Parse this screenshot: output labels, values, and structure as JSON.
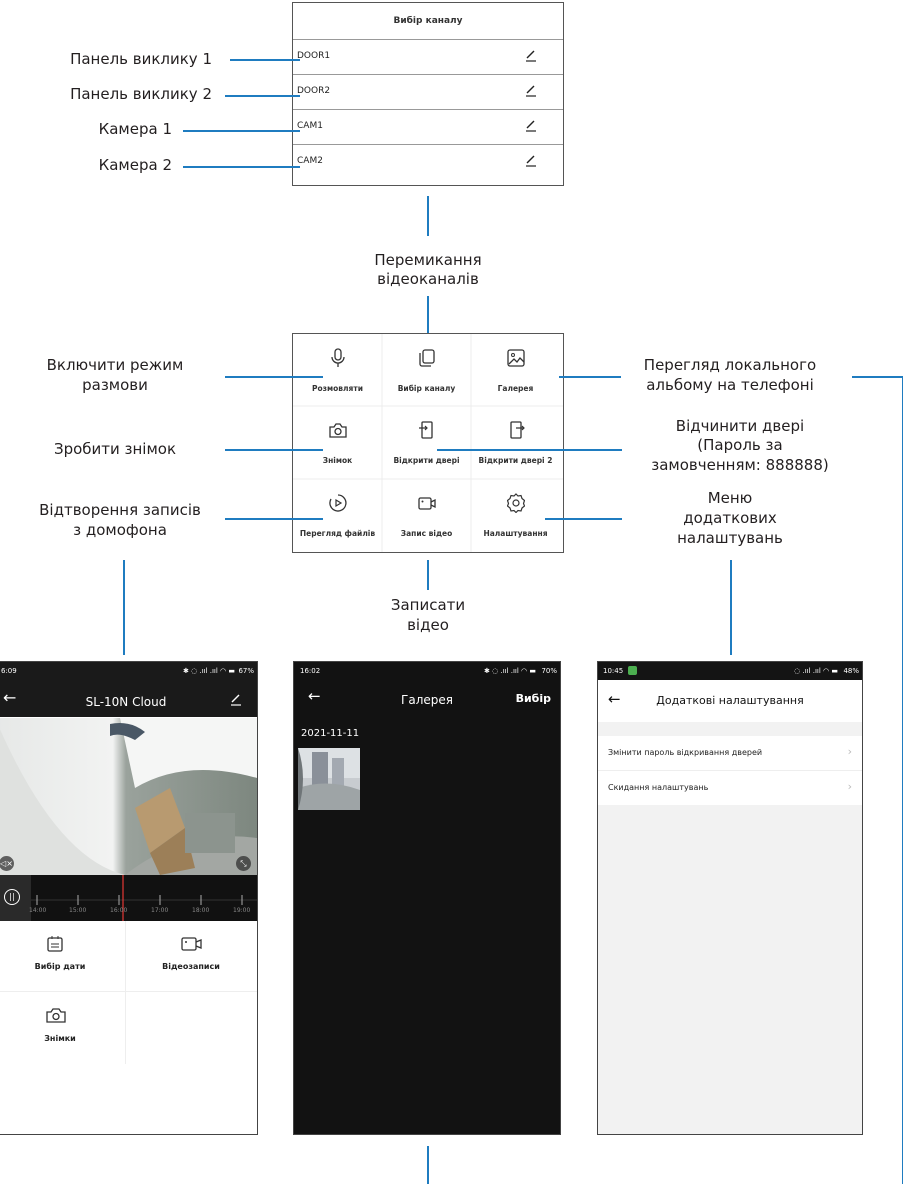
{
  "channel_panel": {
    "title": "Вибір каналу",
    "rows": [
      "DOOR1",
      "DOOR2",
      "CAM1",
      "CAM2"
    ]
  },
  "annotations": {
    "panel1": "Панель виклику 1",
    "panel2": "Панель виклику 2",
    "cam1": "Камера 1",
    "cam2": "Камера 2",
    "switch_l1": "Перемикання",
    "switch_l2": "відеоканалів",
    "talk_l1": "Включити режим",
    "talk_l2": "размови",
    "snap": "Зробити знімок",
    "playback_l1": "Відтворення записів",
    "playback_l2": "з домофона",
    "gallery_l1": "Перегляд локального",
    "gallery_l2": "альбому на телефоні",
    "door_l1": "Відчинити двері",
    "door_l2": "(Пароль за",
    "door_l3": "замовченням: 888888)",
    "menu_l1": "Меню",
    "menu_l2": "додаткових",
    "menu_l3": "налаштувань",
    "rec_l1": "Записати",
    "rec_l2": "відео"
  },
  "grid": {
    "cells": [
      {
        "label": "Розмовляти",
        "icon": "microphone-icon"
      },
      {
        "label": "Вибір каналу",
        "icon": "channel-icon"
      },
      {
        "label": "Галерея",
        "icon": "image-icon"
      },
      {
        "label": "Знімок",
        "icon": "camera-icon"
      },
      {
        "label": "Відкрити двері",
        "icon": "door-open-icon"
      },
      {
        "label": "Відкрити двері 2",
        "icon": "door-open-icon"
      },
      {
        "label": "Перегляд файлів",
        "icon": "play-icon"
      },
      {
        "label": "Запис відео",
        "icon": "video-icon"
      },
      {
        "label": "Налаштування",
        "icon": "gear-icon"
      }
    ]
  },
  "phone1": {
    "time": "6:09",
    "battery": "67%",
    "title": "SL-10N Cloud",
    "timeline_ticks": [
      "14:00",
      "15:00",
      "16:00",
      "17:00",
      "18:00",
      "19:00"
    ],
    "buttons": {
      "date": "Вибір дати",
      "videos": "Відеозаписи",
      "snaps": "Знімки"
    }
  },
  "phone2": {
    "time": "16:02",
    "battery": "70%",
    "title": "Галерея",
    "select": "Вибір",
    "date": "2021-11-11"
  },
  "phone3": {
    "time": "10:45",
    "battery": "48%",
    "title": "Додаткові налаштування",
    "items": [
      "Змінити пароль відкривання дверей",
      "Скидання налаштувань"
    ]
  },
  "colors": {
    "accent_line": "#1f7cc0",
    "timeline_marker": "#e53935",
    "dark_bg": "#121212"
  }
}
